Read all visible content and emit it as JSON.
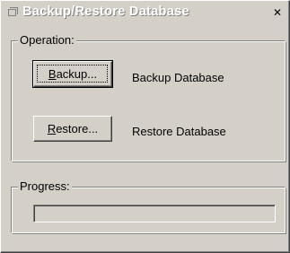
{
  "window": {
    "title": "Backup/Restore Database",
    "icon": "database-icon",
    "close_icon": "close-icon",
    "close_glyph": "✕"
  },
  "operation": {
    "group_label": "Operation:",
    "backup": {
      "button_mnemonic": "B",
      "button_rest": "ackup...",
      "description": "Backup Database"
    },
    "restore": {
      "button_mnemonic": "R",
      "button_rest": "estore...",
      "description": "Restore Database"
    }
  },
  "progress": {
    "group_label": "Progress:",
    "value": 0
  },
  "colors": {
    "face": "#d4d0c8",
    "highlight": "#ffffff",
    "shadow": "#808080"
  }
}
